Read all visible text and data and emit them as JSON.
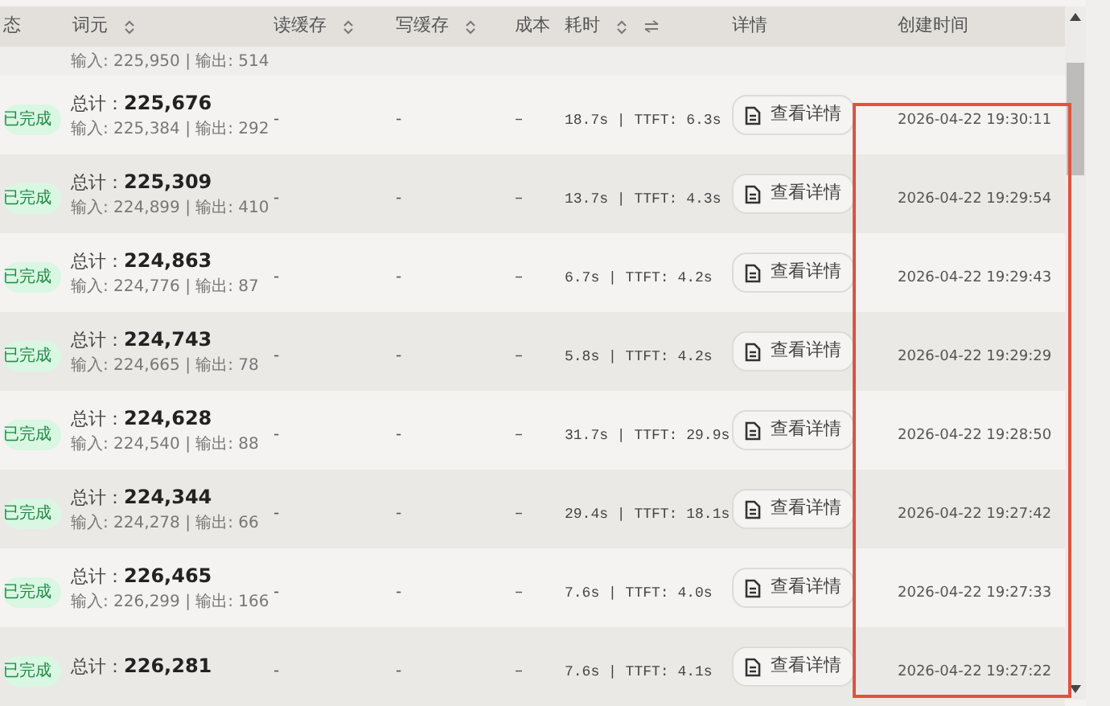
{
  "table": {
    "columns": [
      {
        "label": "态",
        "sortable": false
      },
      {
        "label": "词元",
        "sortable": true
      },
      {
        "label": "读缓存",
        "sortable": true
      },
      {
        "label": "写缓存",
        "sortable": true
      },
      {
        "label": "成本",
        "sortable": false
      },
      {
        "label": "耗时",
        "sortable": true,
        "swap": true
      },
      {
        "label": "详情",
        "sortable": false
      },
      {
        "label": "创建时间",
        "sortable": false
      }
    ],
    "partial_row": {
      "tokens_detail": "输入: 225,950 | 输出: 514"
    },
    "rows": [
      {
        "status": "已完成",
        "total_label": "总计：",
        "total": "225,676",
        "tokens_detail": "输入: 225,384 | 输出: 292",
        "read_cache": "-",
        "write_cache": "-",
        "cost": "–",
        "duration": "18.7s | TTFT: 6.3s",
        "detail_button": "查看详情",
        "created": "2026-04-22 19:30:11"
      },
      {
        "status": "已完成",
        "total_label": "总计：",
        "total": "225,309",
        "tokens_detail": "输入: 224,899 | 输出: 410",
        "read_cache": "-",
        "write_cache": "-",
        "cost": "–",
        "duration": "13.7s | TTFT: 4.3s",
        "detail_button": "查看详情",
        "created": "2026-04-22 19:29:54"
      },
      {
        "status": "已完成",
        "total_label": "总计：",
        "total": "224,863",
        "tokens_detail": "输入: 224,776 | 输出: 87",
        "read_cache": "-",
        "write_cache": "-",
        "cost": "–",
        "duration": "6.7s | TTFT: 4.2s",
        "detail_button": "查看详情",
        "created": "2026-04-22 19:29:43"
      },
      {
        "status": "已完成",
        "total_label": "总计：",
        "total": "224,743",
        "tokens_detail": "输入: 224,665 | 输出: 78",
        "read_cache": "-",
        "write_cache": "-",
        "cost": "–",
        "duration": "5.8s | TTFT: 4.2s",
        "detail_button": "查看详情",
        "created": "2026-04-22 19:29:29"
      },
      {
        "status": "已完成",
        "total_label": "总计：",
        "total": "224,628",
        "tokens_detail": "输入: 224,540 | 输出: 88",
        "read_cache": "-",
        "write_cache": "-",
        "cost": "–",
        "duration": "31.7s | TTFT: 29.9s",
        "detail_button": "查看详情",
        "created": "2026-04-22 19:28:50"
      },
      {
        "status": "已完成",
        "total_label": "总计：",
        "total": "224,344",
        "tokens_detail": "输入: 224,278 | 输出: 66",
        "read_cache": "-",
        "write_cache": "-",
        "cost": "–",
        "duration": "29.4s | TTFT: 18.1s",
        "detail_button": "查看详情",
        "created": "2026-04-22 19:27:42"
      },
      {
        "status": "已完成",
        "total_label": "总计：",
        "total": "226,465",
        "tokens_detail": "输入: 226,299 | 输出: 166",
        "read_cache": "-",
        "write_cache": "-",
        "cost": "–",
        "duration": "7.6s | TTFT: 4.0s",
        "detail_button": "查看详情",
        "created": "2026-04-22 19:27:33"
      },
      {
        "status": "已完成",
        "total_label": "总计：",
        "total": "226,281",
        "tokens_detail": "",
        "read_cache": "-",
        "write_cache": "-",
        "cost": "–",
        "duration": "7.6s | TTFT: 4.1s",
        "detail_button": "查看详情",
        "created": "2026-04-22 19:27:22"
      }
    ]
  }
}
